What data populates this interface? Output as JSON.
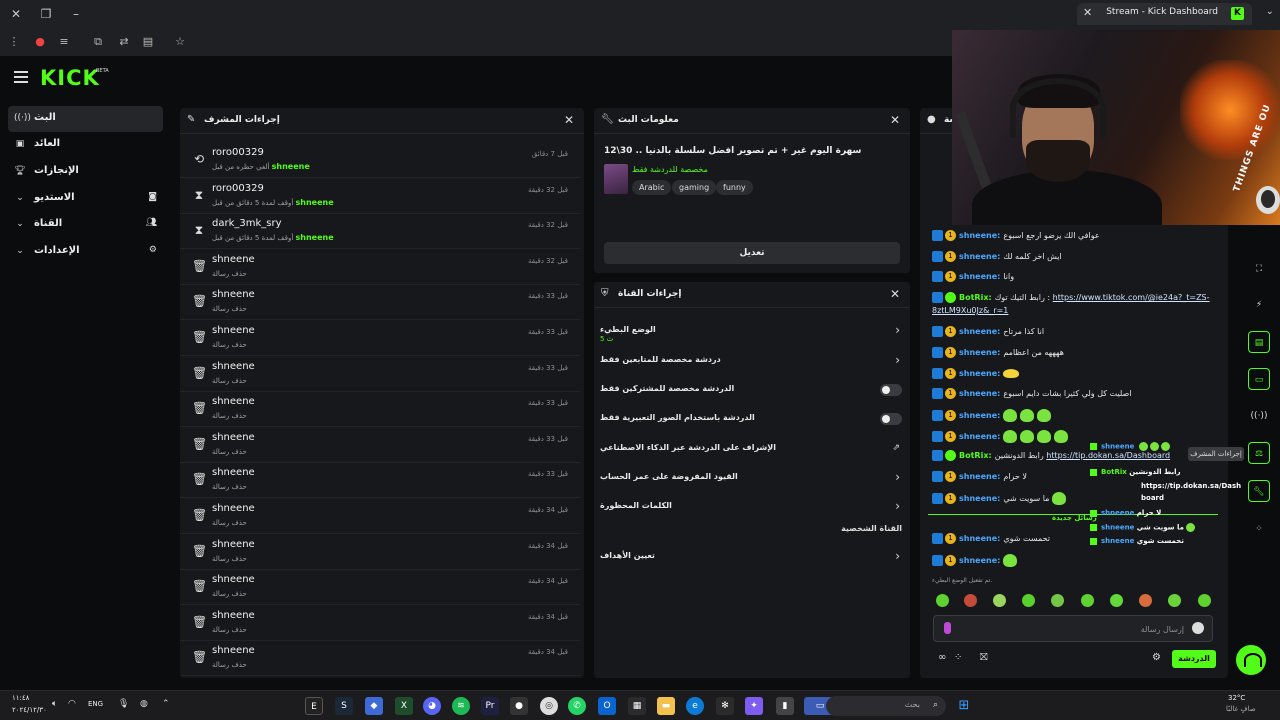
{
  "browser": {
    "tab_title": "Stream - Kick Dashboard",
    "tab_favicon": "K"
  },
  "header": {
    "logo": "KICK",
    "logo_badge": "BETA"
  },
  "sidebar": {
    "items": [
      {
        "label": "البث",
        "icon": "broadcast-icon"
      },
      {
        "label": "العائد",
        "icon": "revenue-icon"
      },
      {
        "label": "الإنجازات",
        "icon": "trophy-icon"
      },
      {
        "label": "الاستديو",
        "icon": "studio-icon"
      },
      {
        "label": "القناة",
        "icon": "channel-icon"
      },
      {
        "label": "الإعدادات",
        "icon": "settings-icon"
      }
    ]
  },
  "mod_actions": {
    "title": "إجراءات المشرف",
    "rows": [
      {
        "icon": "undo-icon",
        "user": "roro00329",
        "desc": "ألغي حظره من قبل",
        "mod": "shneene",
        "time": "قبل 7 دقائق"
      },
      {
        "icon": "timeout-icon",
        "user": "roro00329",
        "desc": "أوقف لمدة 5 دقائق من قبل",
        "mod": "shneene",
        "time": "قبل 32 دقيقة"
      },
      {
        "icon": "timeout-icon",
        "user": "dark_3mk_sry",
        "desc": "أوقف لمدة 5 دقائق من قبل",
        "mod": "shneene",
        "time": "قبل 32 دقيقة"
      },
      {
        "icon": "trash-icon",
        "user": "shneene",
        "desc": "حذف رسالة",
        "mod": "",
        "time": "قبل 32 دقيقة"
      },
      {
        "icon": "trash-icon",
        "user": "shneene",
        "desc": "حذف رسالة",
        "mod": "",
        "time": "قبل 33 دقيقة"
      },
      {
        "icon": "trash-icon",
        "user": "shneene",
        "desc": "حذف رسالة",
        "mod": "",
        "time": "قبل 33 دقيقة"
      },
      {
        "icon": "trash-icon",
        "user": "shneene",
        "desc": "حذف رسالة",
        "mod": "",
        "time": "قبل 33 دقيقة"
      },
      {
        "icon": "trash-icon",
        "user": "shneene",
        "desc": "حذف رسالة",
        "mod": "",
        "time": "قبل 33 دقيقة"
      },
      {
        "icon": "trash-icon",
        "user": "shneene",
        "desc": "حذف رسالة",
        "mod": "",
        "time": "قبل 33 دقيقة"
      },
      {
        "icon": "trash-icon",
        "user": "shneene",
        "desc": "حذف رسالة",
        "mod": "",
        "time": "قبل 33 دقيقة"
      },
      {
        "icon": "trash-icon",
        "user": "shneene",
        "desc": "حذف رسالة",
        "mod": "",
        "time": "قبل 34 دقيقة"
      },
      {
        "icon": "trash-icon",
        "user": "shneene",
        "desc": "حذف رسالة",
        "mod": "",
        "time": "قبل 34 دقيقة"
      },
      {
        "icon": "trash-icon",
        "user": "shneene",
        "desc": "حذف رسالة",
        "mod": "",
        "time": "قبل 34 دقيقة"
      },
      {
        "icon": "trash-icon",
        "user": "shneene",
        "desc": "حذف رسالة",
        "mod": "",
        "time": "قبل 34 دقيقة"
      },
      {
        "icon": "trash-icon",
        "user": "shneene",
        "desc": "حذف رسالة",
        "mod": "",
        "time": "قبل 34 دقيقة"
      }
    ]
  },
  "stream_info": {
    "title": "معلومات البث",
    "stream_title": "سهرة اليوم غير + تم تصوير افضل سلسلة بالدنيا .. 30\\12",
    "category": "مخصصة للدردشة فقط",
    "tags": [
      "Arabic",
      "gaming",
      "funny"
    ],
    "edit_label": "تعديل"
  },
  "channel_actions": {
    "title": "إجراءات القناة",
    "rows": [
      {
        "label": "الوضع البطيء",
        "sub": "5 ث",
        "control": "chevron"
      },
      {
        "label": "دردشة مخصصة للمتابعين فقط",
        "sub": "",
        "control": "chevron"
      },
      {
        "label": "الدردشة مخصصة للمشتركين فقط",
        "sub": "",
        "control": "toggle"
      },
      {
        "label": "الدردشة باستخدام الصور التعبيرية فقط",
        "sub": "",
        "control": "toggle"
      },
      {
        "label": "الإشراف على الدردشة عبر الذكاء الاصطناعي",
        "sub": "",
        "control": "external"
      },
      {
        "label": "القيود المفروضة على عمر الحساب",
        "sub": "",
        "control": "chevron"
      },
      {
        "label": "الكلمات المحظورة",
        "sub": "",
        "control": "chevron"
      },
      {
        "label": "تعيين الأهداف",
        "sub": "",
        "control": "chevron"
      }
    ],
    "section_label": "القناة الشخصية"
  },
  "chat": {
    "header_title": "دردشة",
    "messages": [
      {
        "user": "shneene",
        "bot": false,
        "text": "عوافي الك يرضو ارجع اسبوع",
        "emotes": 0
      },
      {
        "user": "shneene",
        "bot": false,
        "text": "ايش اخر كلمه لك",
        "emotes": 0
      },
      {
        "user": "shneene",
        "bot": false,
        "text": "وانا",
        "emotes": 0
      },
      {
        "user": "BotRix",
        "bot": true,
        "text": "رابط التيك توك :",
        "link": "https://www.tiktok.com/@ie24a?_t=ZS-",
        "emotes": 0
      },
      {
        "user": "",
        "bot": false,
        "text": "",
        "link": "8ztLM9Xu0Jz&_r=1",
        "emotes": 0,
        "continuation": true
      },
      {
        "user": "shneene",
        "bot": false,
        "text": "انا كذا مرتاح",
        "emotes": 0
      },
      {
        "user": "shneene",
        "bot": false,
        "text": "ههههه من اعظامم",
        "emotes": 0
      },
      {
        "user": "shneene",
        "bot": false,
        "text": "",
        "emotes": 1,
        "emote_type": "yellow"
      },
      {
        "user": "shneene",
        "bot": false,
        "text": "اصليت كل ولي كثيرا بشات دايم اسبوع",
        "emotes": 0
      },
      {
        "user": "shneene",
        "bot": false,
        "text": "",
        "emotes": 3
      },
      {
        "user": "shneene",
        "bot": false,
        "text": "",
        "emotes": 4
      },
      {
        "user": "BotRix",
        "bot": true,
        "text": "رابط الدونشين",
        "link": "https://tip.dokan.sa/Dashboard",
        "emotes": 0
      },
      {
        "user": "shneene",
        "bot": false,
        "text": "لا حرام",
        "emotes": 0
      },
      {
        "user": "shneene",
        "bot": false,
        "text": "ما سويت شي",
        "emotes": 1
      },
      {
        "user": "shneene",
        "bot": false,
        "text": "تحمست شوي",
        "emotes": 0
      },
      {
        "user": "shneene",
        "bot": false,
        "text": "",
        "emotes": 1
      }
    ],
    "new_messages_label": "رسائل جديدة",
    "slow_mode_notice": "تم تفعيل الوضع البطيء.",
    "input_placeholder": "إرسال رسالة",
    "send_label": "الدردشة"
  },
  "overlay_chat": {
    "lines": [
      {
        "user": "shneene",
        "text": "",
        "emotes": 3
      },
      {
        "user": "BotRix",
        "text": "رابط الدونشين",
        "bot": true
      },
      {
        "user": "",
        "text": "https://tip.dokan.sa/Dash"
      },
      {
        "user": "",
        "text": "board"
      },
      {
        "user": "shneene",
        "text": "لا حرام"
      },
      {
        "user": "shneene",
        "text": "ما سويت شي",
        "emotes": 1
      },
      {
        "user": "shneene",
        "text": "تحمست شوي"
      }
    ]
  },
  "webcam": {
    "overlay_text": "THINGS ARE OU"
  },
  "right_rail": {
    "tooltip": "إجراءات المشرف"
  },
  "taskbar": {
    "search_placeholder": "بحث",
    "weather_temp": "32°C",
    "weather_cond": "صافٍ غالبًا",
    "time": "١١:٤٨",
    "date": "٢٠٢٤/١٢/٣٠",
    "lang": "ENG"
  },
  "colors": {
    "accent": "#53fc18",
    "panel": "#17181b",
    "background": "#0b0c0e",
    "username": "#4aa8ff"
  }
}
